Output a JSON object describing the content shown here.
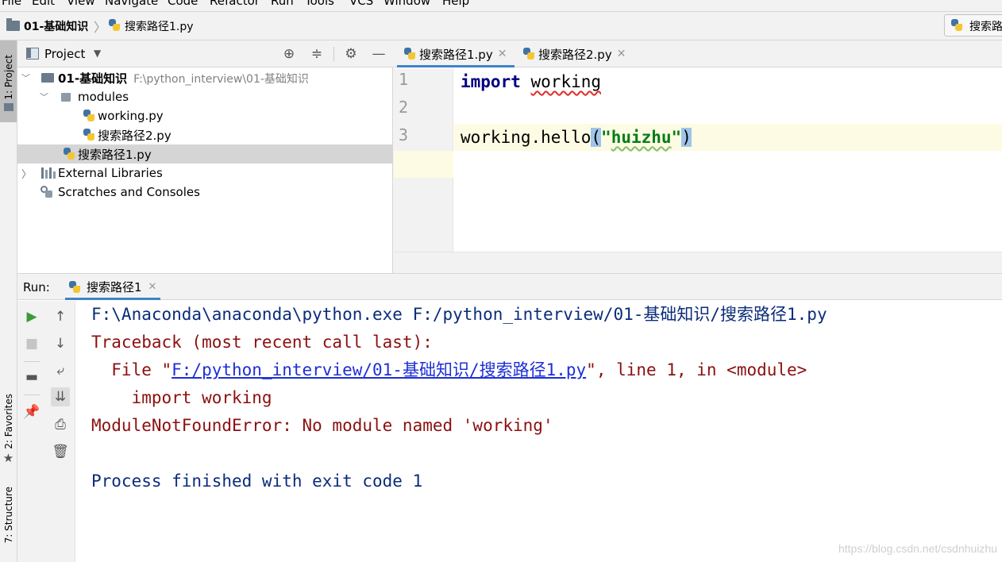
{
  "menu": {
    "items": [
      "File",
      "Edit",
      "View",
      "Navigate",
      "Code",
      "Refactor",
      "Run",
      "Tools",
      "VCS",
      "Window",
      "Help"
    ]
  },
  "navbar": {
    "project": "01-基础知识",
    "file": "搜索路径1.py",
    "run_config": "搜索路"
  },
  "left_stripe": {
    "project": "1: Project",
    "favorites": "2: Favorites",
    "structure": "7: Structure"
  },
  "project_panel": {
    "title": "Project",
    "tree": {
      "root_name": "01-基础知识",
      "root_path": "F:\\python_interview\\01-基础知识",
      "modules": "modules",
      "working": "working.py",
      "search2": "搜索路径2.py",
      "search1": "搜索路径1.py",
      "external": "External Libraries",
      "scratches": "Scratches and Consoles"
    }
  },
  "editor": {
    "tabs": [
      {
        "label": "搜索路径1.py",
        "active": true
      },
      {
        "label": "搜索路径2.py",
        "active": false
      }
    ],
    "line_numbers": [
      "1",
      "2",
      "3"
    ],
    "code": {
      "l1_kw": "import",
      "l1_mod": "working",
      "l3_a": "working.hello",
      "l3_open": "(",
      "l3_q1": "\"",
      "l3_str": "huizhu",
      "l3_q2": "\"",
      "l3_close": ")"
    }
  },
  "run_panel": {
    "label": "Run:",
    "tab": "搜索路径1",
    "console": {
      "cmd": "F:\\Anaconda\\anaconda\\python.exe F:/python_interview/01-基础知识/搜索路径1.py",
      "traceback": "Traceback (most recent call last):",
      "file_pre": "  File \"",
      "file_link": "F:/python_interview/01-基础知识/搜索路径1.py",
      "file_post": "\", line 1, in <module>",
      "import_line": "    import working",
      "error": "ModuleNotFoundError: No module named 'working'",
      "finished": "Process finished with exit code 1"
    }
  },
  "watermark": "https://blog.csdn.net/csdnhuizhu",
  "colors": {
    "accent": "#4083c9",
    "error_text": "#8b1010",
    "console_blue": "#0b2c7a",
    "keyword": "#000080",
    "string": "#067d17"
  }
}
